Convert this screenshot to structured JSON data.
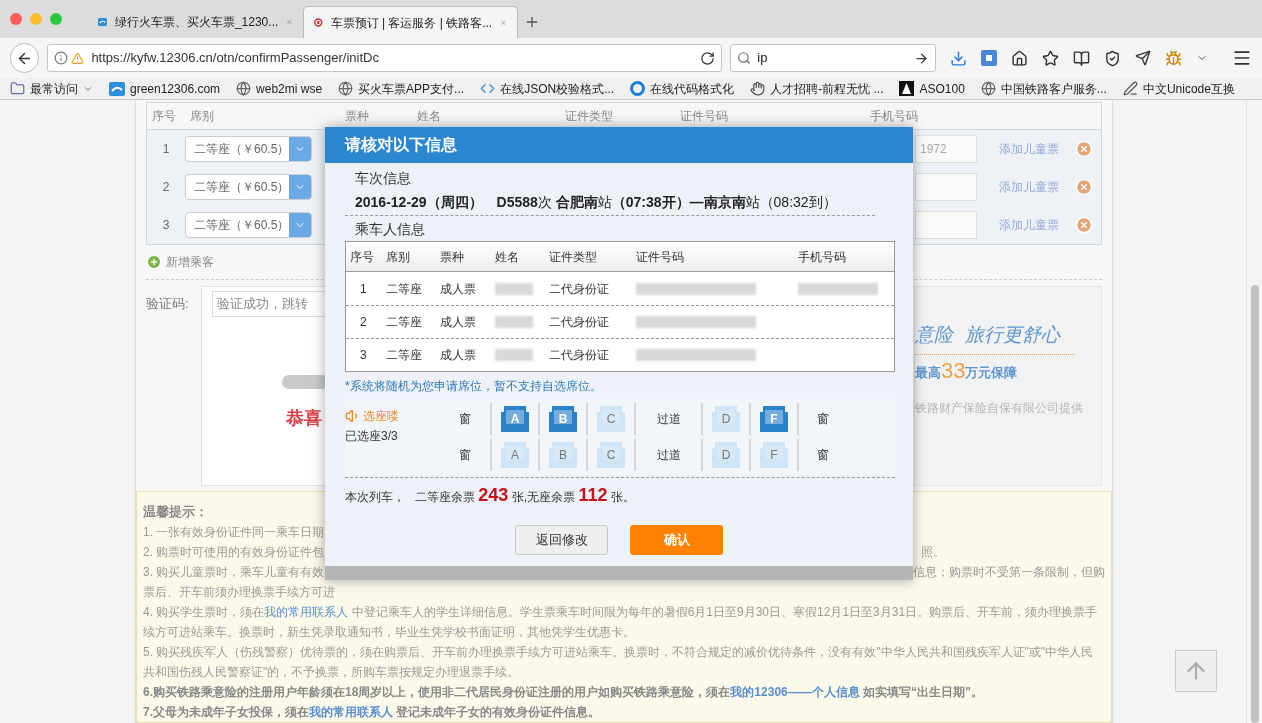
{
  "browser": {
    "tabs": [
      {
        "title": "绿行火车票、买火车票_1230...",
        "selected": false,
        "kind": "cloud"
      },
      {
        "title": "车票预订 | 客运服务 | 铁路客...",
        "selected": true,
        "kind": "rail"
      }
    ],
    "url": "https://kyfw.12306.cn/otn/confirmPassenger/initDc",
    "search": {
      "value": "ip"
    },
    "bookmarks": [
      {
        "label": "最常访问",
        "kind": "folder"
      },
      {
        "label": "green12306.com",
        "kind": "cloud"
      },
      {
        "label": "web2mi wse",
        "kind": "globe"
      },
      {
        "label": "买火车票APP支付...",
        "kind": "globe"
      },
      {
        "label": "在线JSON校验格式...",
        "kind": "code"
      },
      {
        "label": "在线代码格式化",
        "kind": "ring"
      },
      {
        "label": "人才招聘-前程无忧 ...",
        "kind": "hand"
      },
      {
        "label": "ASO100",
        "kind": "square"
      },
      {
        "label": "中国铁路客户服务...",
        "kind": "globe"
      },
      {
        "label": "中文Unicode互换",
        "kind": "pen"
      }
    ]
  },
  "passengers": {
    "columns": [
      "序号",
      "席别",
      "票种",
      "姓名",
      "证件类型",
      "证件号码",
      "手机号码"
    ],
    "rows": [
      {
        "number": "1",
        "seat": "二等座（￥60.5）",
        "phone": "1972",
        "link": "添加儿童票"
      },
      {
        "number": "2",
        "seat": "二等座（￥60.5）",
        "link": "添加儿童票"
      },
      {
        "number": "3",
        "seat": "二等座（￥60.5）",
        "link": "添加儿童票"
      }
    ],
    "add_label": "新增乘客"
  },
  "captcha": {
    "label": "验证码:",
    "message": "验证成功，跳转"
  },
  "left_ad": {
    "text": "恭喜"
  },
  "right_ad": {
    "headline": [
      "意险",
      "旅行更舒心"
    ],
    "max_label": "最高",
    "max_amount": "33",
    "max_unit": "万元保障",
    "provider": "铁路财产保险自保有限公司提供"
  },
  "dialog": {
    "title": "请核对以下信息",
    "train_heading": "车次信息",
    "train_info": "**2016-12-29（周四）　D5588**次 **合肥南**站**（07:38开）—南京南**站（08:32到）",
    "passenger_heading": "乘车人信息",
    "columns": [
      "序号",
      "席别",
      "票种",
      "姓名",
      "证件类型",
      "证件号码",
      "手机号码"
    ],
    "rows": [
      {
        "number": "1",
        "seat": "二等座",
        "ticket_type": "成人票",
        "id_type": "二代身份证",
        "phone_shown": true
      },
      {
        "number": "2",
        "seat": "二等座",
        "ticket_type": "成人票",
        "id_type": "二代身份证",
        "phone_shown": false
      },
      {
        "number": "3",
        "seat": "二等座",
        "ticket_type": "成人票",
        "id_type": "二代身份证",
        "phone_shown": false
      }
    ],
    "note": "*系统将随机为您申请席位，暂不支持自选席位。",
    "seat_selection": {
      "title": "选座喽",
      "status": "已选座3/3",
      "rows": [
        {
          "items": [
            {
              "kind": "window",
              "label": "窗"
            },
            {
              "kind": "seat",
              "label": "A",
              "selected": true
            },
            {
              "kind": "seat",
              "label": "B",
              "selected": true
            },
            {
              "kind": "seat",
              "label": "C",
              "selected": false
            },
            {
              "kind": "aisle",
              "label": "过道"
            },
            {
              "kind": "seat",
              "label": "D",
              "selected": false
            },
            {
              "kind": "seat",
              "label": "F",
              "selected": true
            },
            {
              "kind": "window",
              "label": "窗"
            }
          ]
        },
        {
          "items": [
            {
              "kind": "window",
              "label": "窗"
            },
            {
              "kind": "seat",
              "label": "A",
              "selected": false
            },
            {
              "kind": "seat",
              "label": "B",
              "selected": false
            },
            {
              "kind": "seat",
              "label": "C",
              "selected": false
            },
            {
              "kind": "aisle",
              "label": "过道"
            },
            {
              "kind": "seat",
              "label": "D",
              "selected": false
            },
            {
              "kind": "seat",
              "label": "F",
              "selected": false
            },
            {
              "kind": "window",
              "label": "窗"
            }
          ]
        }
      ]
    },
    "availability": {
      "intro": "本次列车，",
      "items": [
        {
          "label": "二等座余票",
          "count": "243",
          "unit": "张,"
        },
        {
          "label": "无座余票",
          "count": "112",
          "unit": "张。"
        }
      ]
    },
    "buttons": [
      {
        "label": "返回修改",
        "kind": "secondary"
      },
      {
        "label": "确认",
        "kind": "primary"
      }
    ]
  },
  "tips": {
    "title": "温馨提示：",
    "partial_lines": [
      {
        "left": "1. 一张有效身份证件同一乘车日期"
      },
      {
        "left": "2. 购票时可使用的有效身份证件包",
        "right": "照。"
      },
      {
        "left": "3. 购买儿童票时，乘车儿童有有效",
        "right": "信息；购票时不受第一条限制，但购"
      },
      {
        "left": "票后、开车前须办理换票手续方可进"
      }
    ],
    "items": [
      {
        "bold": false,
        "parts": [
          {
            "text": "4. 购买学生票时，须在"
          },
          {
            "text": "我的常用联系人",
            "link": true
          },
          {
            "text": " 中登记乘车人的学生详细信息。学生票乘车时间限为每年的暑假6月1日至9月30日、寒假12月1日至3月31日。购票后、开车前，须办理换票手续方可进站乘车。换票时，新生凭录取通知书，毕业生凭学校书面证明，其他凭学生优惠卡。"
          }
        ]
      },
      {
        "bold": false,
        "parts": [
          {
            "text": "5. 购买残疾军人（伤残警察）优待票的，须在购票后、开车前办理换票手续方可进站乘车。换票时，不符合规定的减价优待条件，没有有效\"中华人民共和国残疾军人证\"或\"中华人民共和国伤残人民警察证\"的，不予换票，所购车票按规定办理退票手续。"
          }
        ]
      },
      {
        "bold": true,
        "parts": [
          {
            "text": "6.购买铁路乘意险的注册用户年龄须在18周岁以上，使用非二代居民身份证注册的用户如购买铁路乘意险，须在"
          },
          {
            "text": "我的12306——个人信息",
            "link": true
          },
          {
            "text": " 如实填写“出生日期”。"
          }
        ]
      },
      {
        "bold": true,
        "parts": [
          {
            "text": "7.父母为未成年子女投保，须在"
          },
          {
            "text": "我的常用联系人",
            "link": true
          },
          {
            "text": " 登记未成年子女的有效身份证件信息。"
          }
        ]
      }
    ]
  }
}
